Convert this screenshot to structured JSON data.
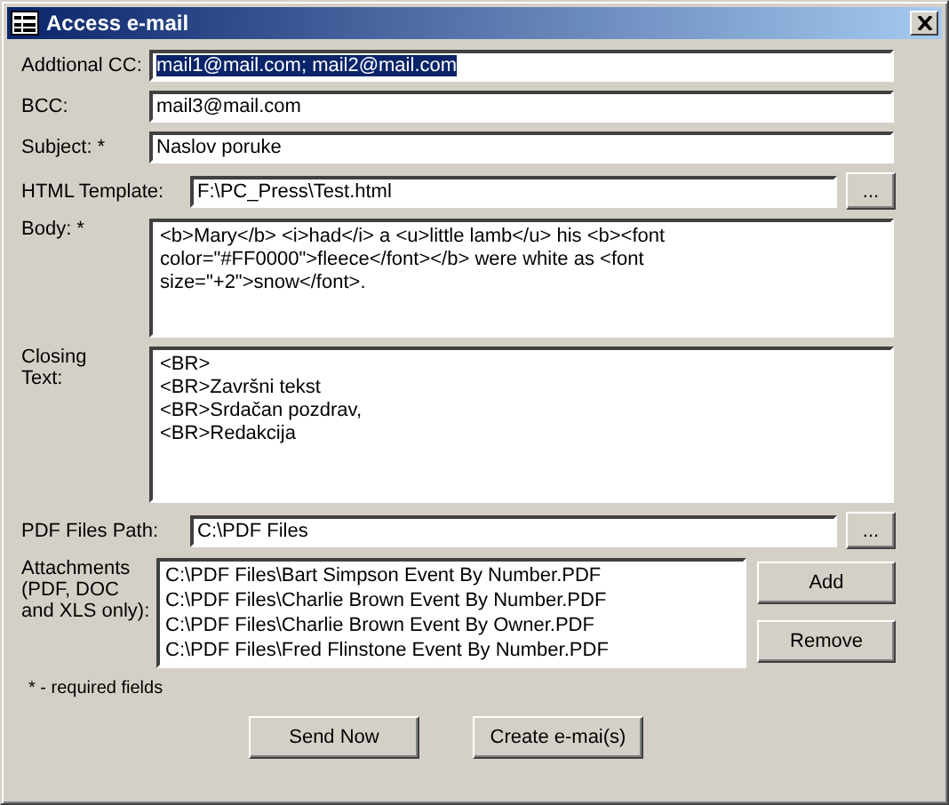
{
  "window": {
    "title": "Access e-mail"
  },
  "fields": [
    {
      "kind": "text",
      "label": "Addtional CC:",
      "value": "mail1@mail.com; mail2@mail.com",
      "selected": true
    },
    {
      "kind": "text",
      "label": "BCC:",
      "value": "mail3@mail.com",
      "selected": false
    },
    {
      "kind": "text",
      "label": "Subject: *",
      "value": "Naslov poruke",
      "selected": false
    },
    {
      "kind": "browse",
      "label": "HTML Template:",
      "value": "F:\\PC_Press\\Test.html",
      "button": "...",
      "selected": false
    },
    {
      "kind": "memo",
      "label": "Body: *",
      "lines": [
        "<b>Mary</b> <i>had</i> a <u>little lamb</u> his <b><font",
        "color=\"#FF0000\">fleece</font></b> were white as <font",
        "size=\"+2\">snow</font>."
      ]
    },
    {
      "kind": "memo",
      "label": "Closing Text:",
      "lines": [
        "<BR>",
        "<BR>Završni tekst",
        "<BR>Srdačan pozdrav,",
        "<BR>Redakcija"
      ]
    },
    {
      "kind": "browse",
      "label": "PDF Files Path:",
      "value": "C:\\PDF Files",
      "button": "...",
      "selected": false
    }
  ],
  "attachments": {
    "label": "(PDF, DOC and XLS only):",
    "label_top": "Attachments",
    "items": [
      "C:\\PDF Files\\Bart Simpson Event By Number.PDF",
      "C:\\PDF Files\\Charlie Brown Event By Number.PDF",
      "C:\\PDF Files\\Charlie Brown Event By Owner.PDF",
      "C:\\PDF Files\\Fred Flinstone Event By Number.PDF"
    ],
    "buttons": [
      {
        "label": "Add"
      },
      {
        "label": "Remove"
      }
    ]
  },
  "note": "* - required fields",
  "buttons": [
    {
      "label": "Send Now"
    },
    {
      "label": "Create e-mai(s)"
    }
  ]
}
